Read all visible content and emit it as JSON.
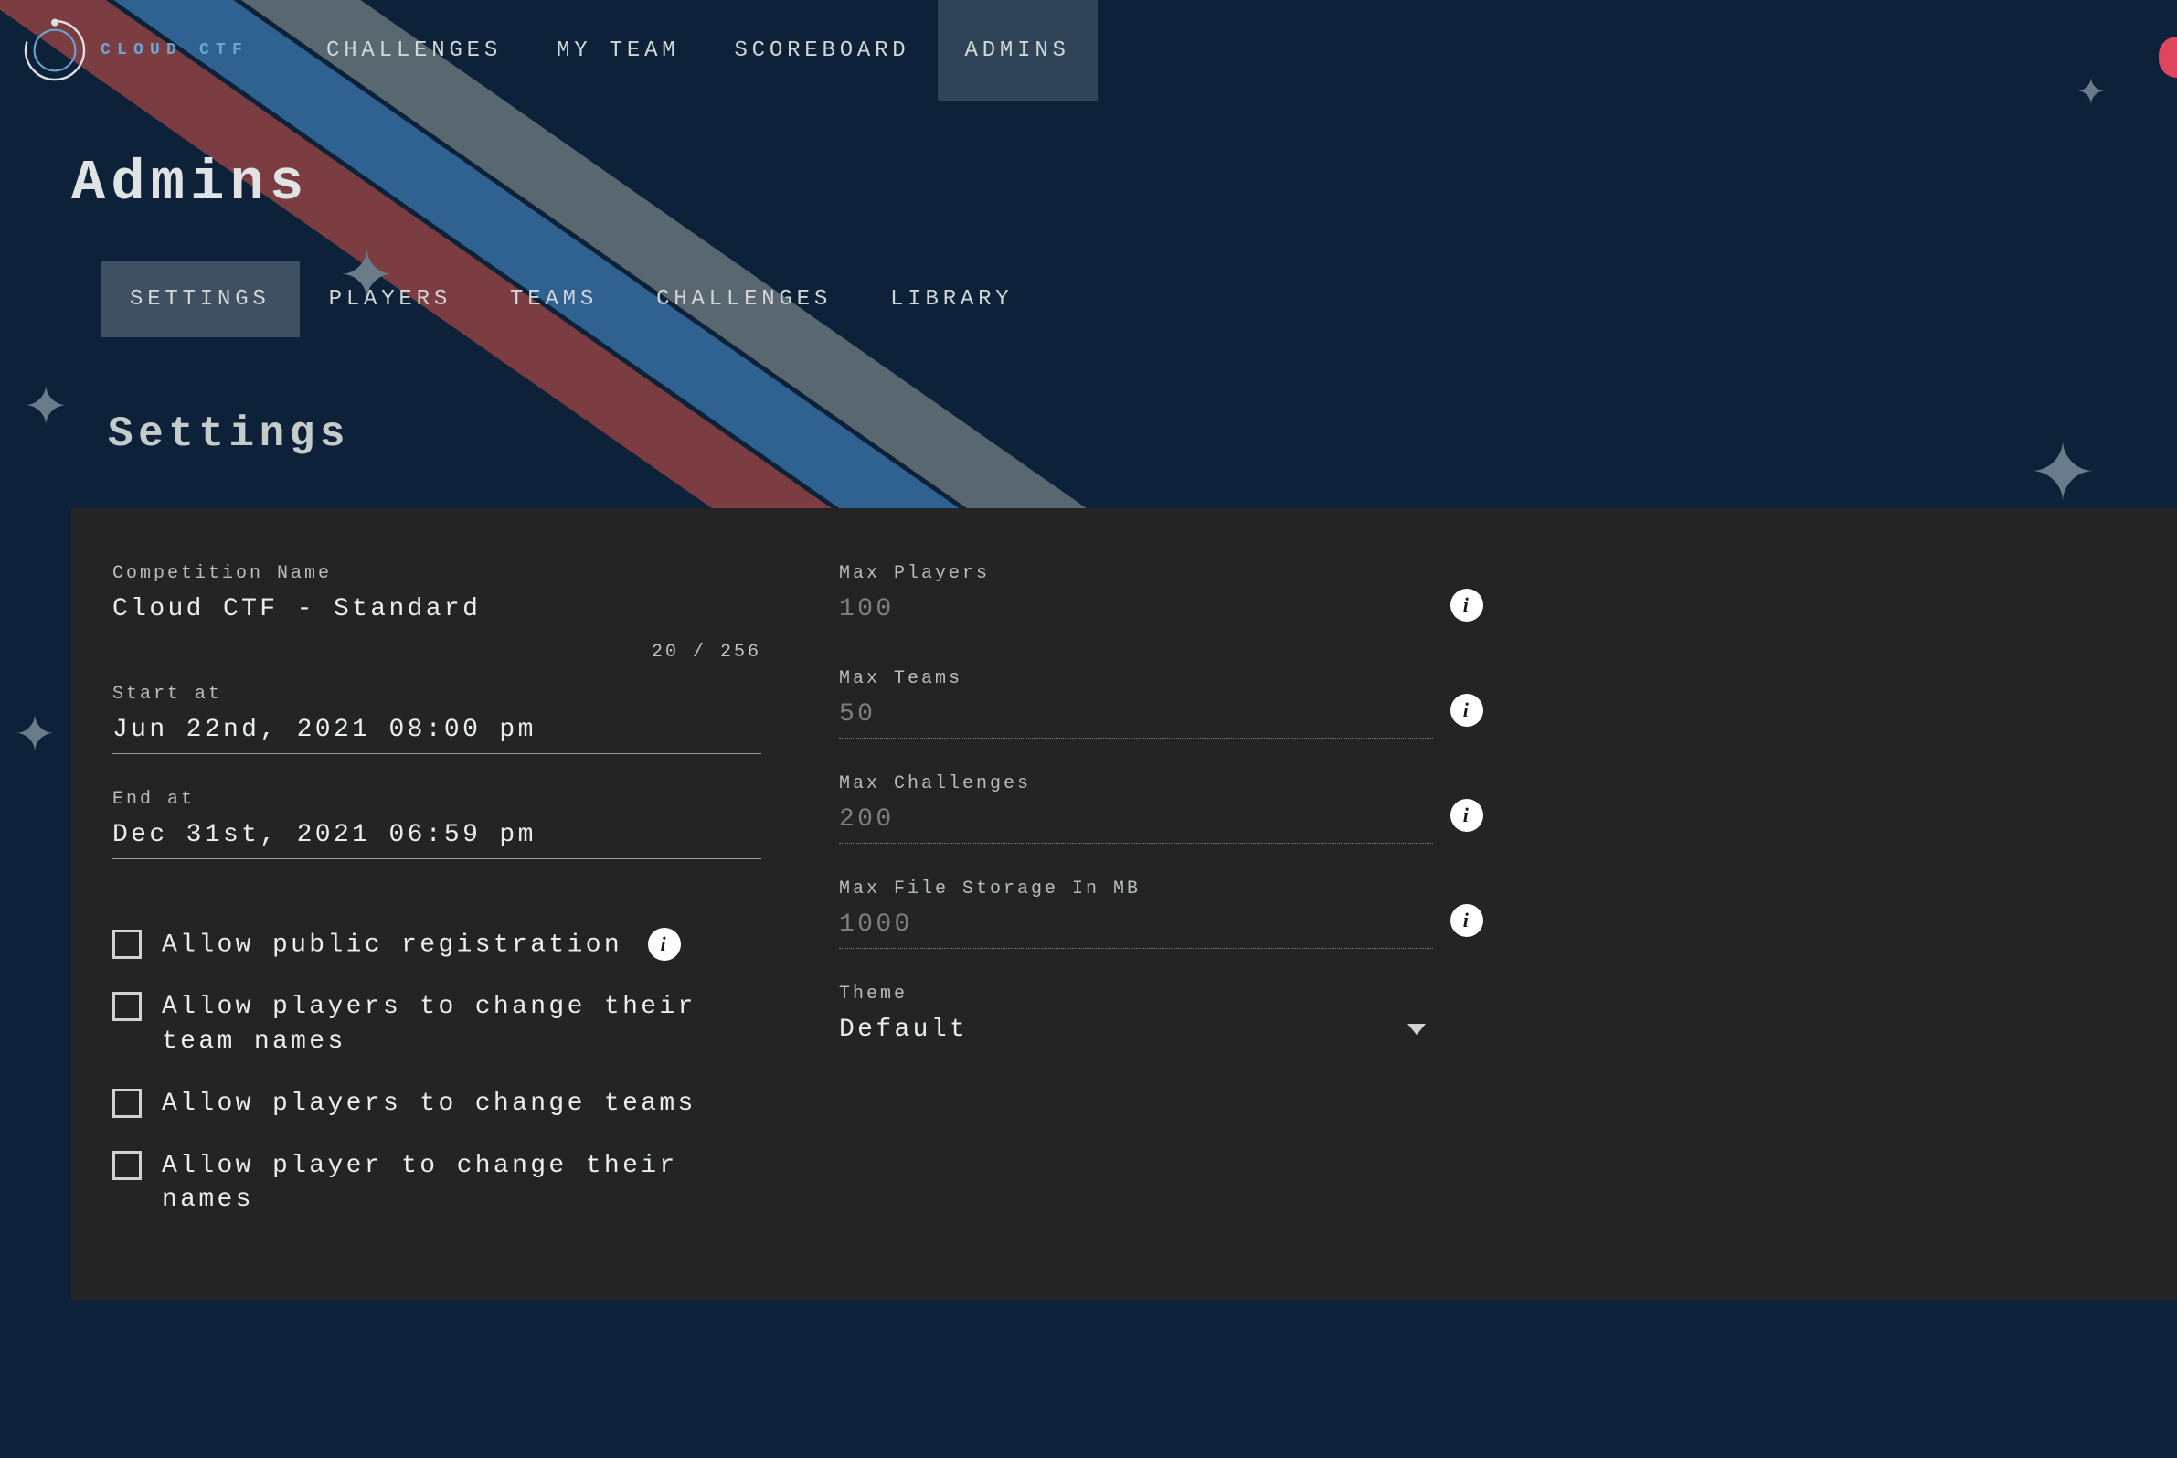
{
  "brand": "CLOUD CTF",
  "nav": {
    "items": [
      {
        "label": "CHALLENGES"
      },
      {
        "label": "MY TEAM"
      },
      {
        "label": "SCOREBOARD"
      },
      {
        "label": "ADMINS"
      }
    ],
    "active_index": 3
  },
  "page_title": "Admins",
  "subtabs": {
    "items": [
      {
        "label": "SETTINGS"
      },
      {
        "label": "PLAYERS"
      },
      {
        "label": "TEAMS"
      },
      {
        "label": "CHALLENGES"
      },
      {
        "label": "LIBRARY"
      }
    ],
    "active_index": 0
  },
  "section_title": "Settings",
  "form": {
    "competition_name": {
      "label": "Competition Name",
      "value": "Cloud CTF - Standard",
      "counter": "20 / 256"
    },
    "start_at": {
      "label": "Start at",
      "value": "Jun 22nd, 2021 08:00 pm"
    },
    "end_at": {
      "label": "End at",
      "value": "Dec 31st, 2021 06:59 pm"
    },
    "max_players": {
      "label": "Max Players",
      "value": "100"
    },
    "max_teams": {
      "label": "Max Teams",
      "value": "50"
    },
    "max_challenges": {
      "label": "Max Challenges",
      "value": "200"
    },
    "max_storage": {
      "label": "Max File Storage In MB",
      "value": "1000"
    },
    "theme": {
      "label": "Theme",
      "value": "Default"
    }
  },
  "checkboxes": {
    "public_reg": {
      "label": "Allow public registration",
      "checked": false
    },
    "change_team_names": {
      "label": "Allow players to change their team names",
      "checked": false
    },
    "change_teams": {
      "label": "Allow players to change teams",
      "checked": false
    },
    "change_names": {
      "label": "Allow player to change their names",
      "checked": false
    }
  }
}
